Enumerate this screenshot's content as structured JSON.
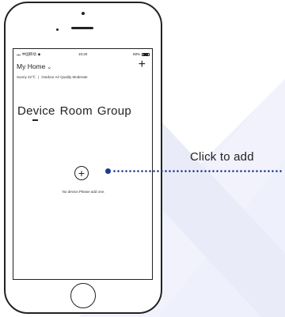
{
  "status_bar": {
    "carrier": "中国移动",
    "time": "10:20",
    "battery": "68%"
  },
  "header": {
    "home_name": "My Home",
    "chevron": "⌄",
    "add_symbol": "+"
  },
  "weather": {
    "condition": "Sunny 22℃",
    "separator": "|",
    "air_quality": "Outdoor Air Quality Moderate"
  },
  "tabs": [
    {
      "label": "Device",
      "selected": true
    },
    {
      "label": "Room",
      "selected": false
    },
    {
      "label": "Group",
      "selected": false
    }
  ],
  "empty_state": {
    "add_symbol": "+",
    "message": "No device.Please add one."
  },
  "callout": {
    "text": "Click to add",
    "color": "#1f3b8c"
  },
  "icons": {
    "signal": "signal-icon",
    "wifi": "wifi-icon",
    "battery": "battery-icon"
  }
}
